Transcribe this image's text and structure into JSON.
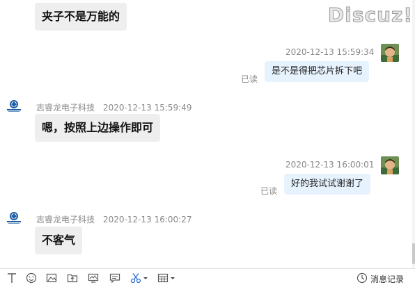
{
  "watermark": "Discuz!",
  "messages": {
    "m1": {
      "text": "夹子不是万能的"
    },
    "m2": {
      "time": "2020-12-13 15:59:34",
      "read": "已读",
      "text": "是不是得把芯片拆下吧"
    },
    "m3": {
      "sender": "志睿龙电子科技",
      "time": "2020-12-13 15:59:49",
      "text": "嗯，按照上边操作即可"
    },
    "m4": {
      "time": "2020-12-13 16:00:01",
      "read": "已读",
      "text": "好的我试试谢谢了"
    },
    "m5": {
      "sender": "志睿龙电子科技",
      "time": "2020-12-13 16:00:27",
      "text": "不客气"
    }
  },
  "toolbar": {
    "icons": [
      "text-format-icon",
      "emoji-icon",
      "image-icon",
      "folder-icon",
      "screen-capture-icon",
      "chat-bubble-icon",
      "scissors-icon",
      "grid-icon"
    ],
    "history_label": "消息记录"
  }
}
